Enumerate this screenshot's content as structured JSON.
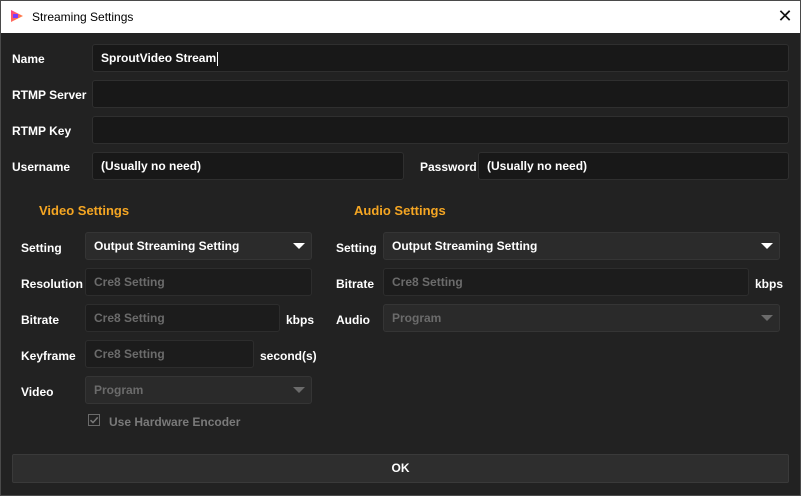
{
  "window": {
    "title": "Streaming Settings",
    "close_glyph": "✕"
  },
  "form": {
    "name_label": "Name",
    "name_value": "SproutVideo Stream",
    "rtmp_server_label": "RTMP Server",
    "rtmp_server_value": "",
    "rtmp_key_label": "RTMP Key",
    "rtmp_key_value": "",
    "username_label": "Username",
    "username_value": "(Usually no need)",
    "password_label": "Password",
    "password_value": "(Usually no need)"
  },
  "video": {
    "heading": "Video Settings",
    "setting_label": "Setting",
    "setting_value": "Output Streaming Setting",
    "resolution_label": "Resolution",
    "resolution_placeholder": "Cre8 Setting",
    "bitrate_label": "Bitrate",
    "bitrate_placeholder": "Cre8 Setting",
    "bitrate_unit": "kbps",
    "keyframe_label": "Keyframe",
    "keyframe_placeholder": "Cre8 Setting",
    "keyframe_unit": "second(s)",
    "video_label": "Video",
    "video_value": "Program",
    "hw_encoder_label": "Use Hardware Encoder",
    "hw_encoder_checked": true
  },
  "audio": {
    "heading": "Audio Settings",
    "setting_label": "Setting",
    "setting_value": "Output Streaming Setting",
    "bitrate_label": "Bitrate",
    "bitrate_placeholder": "Cre8 Setting",
    "bitrate_unit": "kbps",
    "audio_label": "Audio",
    "audio_value": "Program"
  },
  "ok_label": "OK",
  "colors": {
    "accent": "#f5a623",
    "background": "#222222",
    "field": "#181818"
  },
  "icons": {
    "app": "cre8-app-icon",
    "close": "close-icon",
    "dropdown": "chevron-down-icon",
    "check": "checkmark-icon"
  }
}
